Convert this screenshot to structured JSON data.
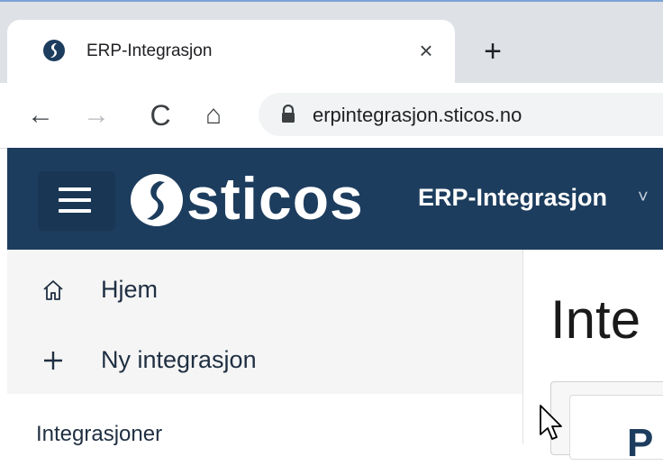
{
  "browser": {
    "tab": {
      "title": "ERP-Integrasjon",
      "close_glyph": "×",
      "favicon": "sticos-logo-icon"
    },
    "new_tab_glyph": "+",
    "nav": {
      "back_glyph": "←",
      "forward_glyph": "→",
      "reload_glyph": "C",
      "home_glyph": "⌂"
    },
    "address": {
      "url": "erpintegrasjon.sticos.no",
      "lock_icon": "lock-icon"
    }
  },
  "app": {
    "brand": "sticos",
    "product": "ERP-Integrasjon",
    "product_chevron": "˅",
    "menu_icon": "hamburger-icon",
    "colors": {
      "header_bg": "#1d3d5e",
      "sidebar_bg": "#f5f5f5",
      "text_dark": "#1f2f42"
    }
  },
  "sidebar": {
    "items": [
      {
        "label": "Hjem",
        "icon": "home-icon"
      },
      {
        "label": "Ny integrasjon",
        "icon": "plus-icon"
      }
    ],
    "section_heading": "Integrasjoner"
  },
  "main": {
    "title": "Inte",
    "card_letter": "P"
  }
}
